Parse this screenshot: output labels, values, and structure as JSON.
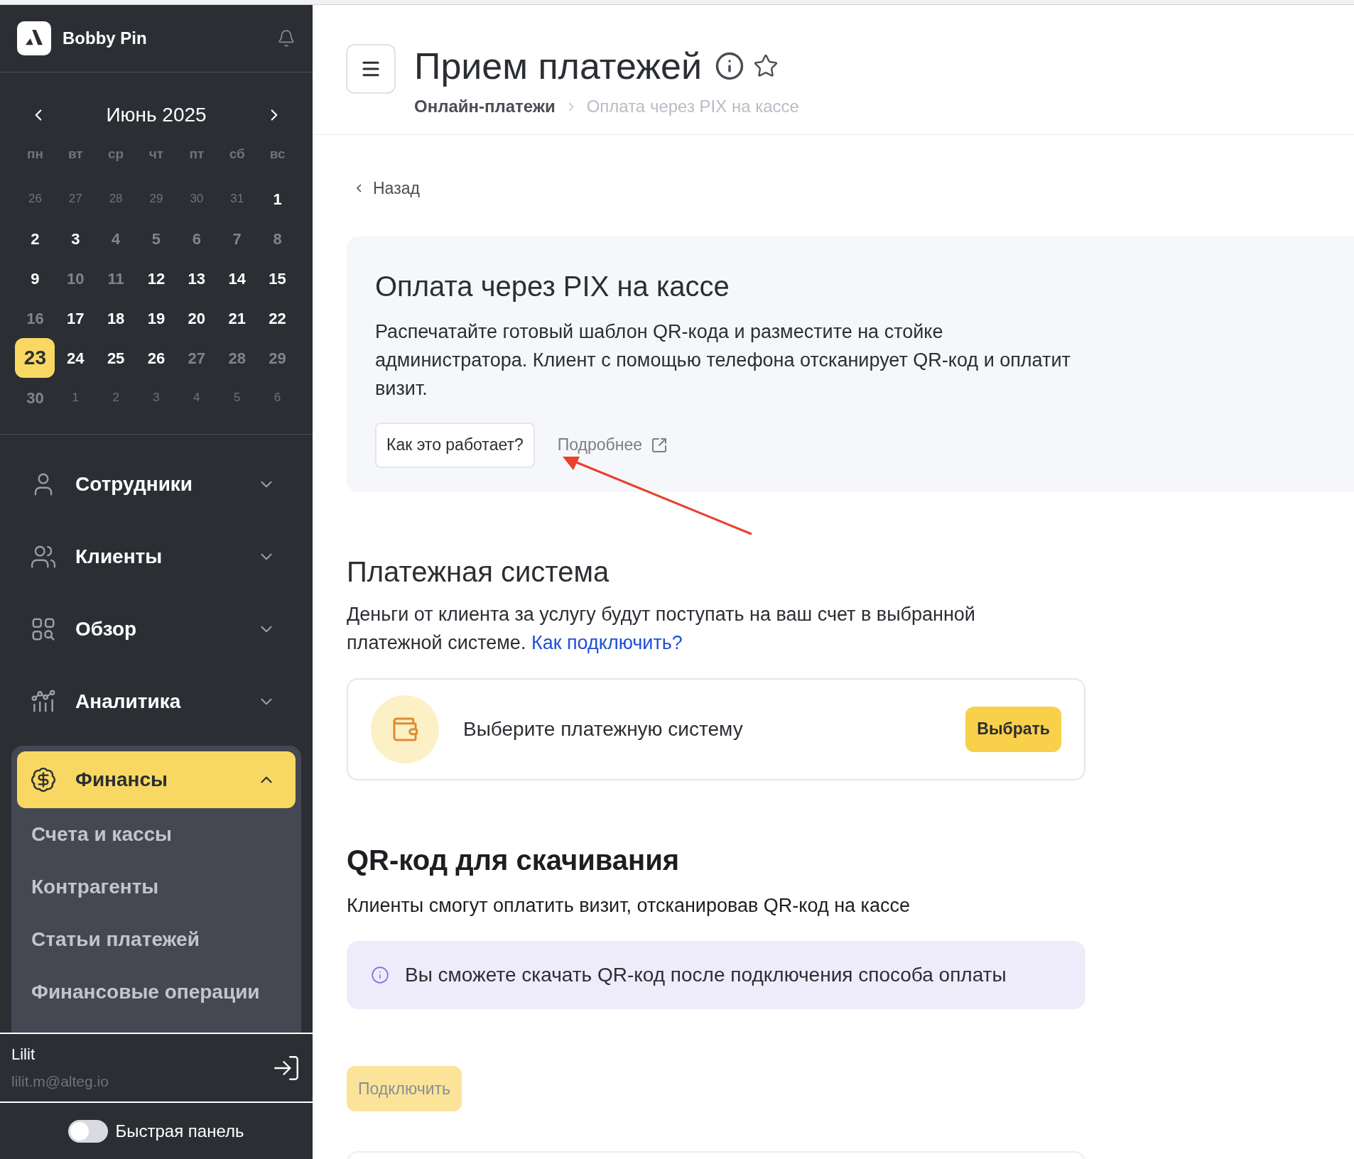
{
  "sidebar": {
    "company": "Bobby Pin",
    "calendar": {
      "month": "Июнь 2025",
      "weekdays": [
        "пн",
        "вт",
        "ср",
        "чт",
        "пт",
        "сб",
        "вс"
      ],
      "days": [
        {
          "text": "26",
          "kind": "other",
          "selected": false
        },
        {
          "text": "27",
          "kind": "other",
          "selected": false
        },
        {
          "text": "28",
          "kind": "other",
          "selected": false
        },
        {
          "text": "29",
          "kind": "other",
          "selected": false
        },
        {
          "text": "30",
          "kind": "other",
          "selected": false
        },
        {
          "text": "31",
          "kind": "other",
          "selected": false
        },
        {
          "text": "1",
          "kind": "work",
          "selected": false
        },
        {
          "text": "2",
          "kind": "work",
          "selected": false
        },
        {
          "text": "3",
          "kind": "work",
          "selected": false
        },
        {
          "text": "4",
          "kind": "off",
          "selected": false
        },
        {
          "text": "5",
          "kind": "off",
          "selected": false
        },
        {
          "text": "6",
          "kind": "off",
          "selected": false
        },
        {
          "text": "7",
          "kind": "off",
          "selected": false
        },
        {
          "text": "8",
          "kind": "off",
          "selected": false
        },
        {
          "text": "9",
          "kind": "work",
          "selected": false
        },
        {
          "text": "10",
          "kind": "off",
          "selected": false
        },
        {
          "text": "11",
          "kind": "off",
          "selected": false
        },
        {
          "text": "12",
          "kind": "work",
          "selected": false
        },
        {
          "text": "13",
          "kind": "work",
          "selected": false
        },
        {
          "text": "14",
          "kind": "work",
          "selected": false
        },
        {
          "text": "15",
          "kind": "work",
          "selected": false
        },
        {
          "text": "16",
          "kind": "off",
          "selected": false
        },
        {
          "text": "17",
          "kind": "work",
          "selected": false
        },
        {
          "text": "18",
          "kind": "work",
          "selected": false
        },
        {
          "text": "19",
          "kind": "work",
          "selected": false
        },
        {
          "text": "20",
          "kind": "work",
          "selected": false
        },
        {
          "text": "21",
          "kind": "work",
          "selected": false
        },
        {
          "text": "22",
          "kind": "work",
          "selected": false
        },
        {
          "text": "23",
          "kind": "work",
          "selected": true
        },
        {
          "text": "24",
          "kind": "work",
          "selected": false
        },
        {
          "text": "25",
          "kind": "work",
          "selected": false
        },
        {
          "text": "26",
          "kind": "work",
          "selected": false
        },
        {
          "text": "27",
          "kind": "off",
          "selected": false
        },
        {
          "text": "28",
          "kind": "off",
          "selected": false
        },
        {
          "text": "29",
          "kind": "off",
          "selected": false
        },
        {
          "text": "30",
          "kind": "off",
          "selected": false
        },
        {
          "text": "1",
          "kind": "other",
          "selected": false
        },
        {
          "text": "2",
          "kind": "other",
          "selected": false
        },
        {
          "text": "3",
          "kind": "other",
          "selected": false
        },
        {
          "text": "4",
          "kind": "other",
          "selected": false
        },
        {
          "text": "5",
          "kind": "other",
          "selected": false
        },
        {
          "text": "6",
          "kind": "other",
          "selected": false
        }
      ]
    },
    "menu": [
      {
        "label": "Сотрудники",
        "expanded": false,
        "selected": false
      },
      {
        "label": "Клиенты",
        "expanded": false,
        "selected": false
      },
      {
        "label": "Обзор",
        "expanded": false,
        "selected": false
      },
      {
        "label": "Аналитика",
        "expanded": false,
        "selected": false
      },
      {
        "label": "Финансы",
        "expanded": true,
        "selected": true,
        "children": [
          {
            "label": "Счета и кассы"
          },
          {
            "label": "Контрагенты"
          },
          {
            "label": "Статьи платежей"
          },
          {
            "label": "Финансовые операции"
          }
        ]
      }
    ],
    "user": {
      "name": "Lilit",
      "email": "lilit.m@alteg.io"
    },
    "quick_panel": {
      "label": "Быстрая панель",
      "on": false
    }
  },
  "header": {
    "title": "Прием платежей",
    "breadcrumbs": [
      "Онлайн-платежи",
      "Оплата через PIX на кассе"
    ]
  },
  "back": "Назад",
  "intro": {
    "title": "Оплата через PIX на кассе",
    "text": "Распечатайте готовый шаблон QR-кода и разместите на стойке администратора. Клиент с помощью телефона отсканирует QR-код и оплатит визит.",
    "how_button": "Как это работает?",
    "more_link": "Подробнее"
  },
  "payment_system": {
    "title": "Платежная система",
    "text": "Деньги от клиента за услугу будут поступать на ваш счет в выбранной платежной системе.",
    "link": "Как подключить?",
    "card": {
      "text": "Выберите платежную систему",
      "button": "Выбрать"
    }
  },
  "qr": {
    "title": "QR-код для скачивания",
    "text": "Клиенты смогут оплатить визит, отсканировав QR-код на кассе",
    "notice": "Вы сможете скачать QR-код после подключения способа оплаты"
  },
  "connect_button": {
    "label": "Подключить",
    "disabled": true
  }
}
